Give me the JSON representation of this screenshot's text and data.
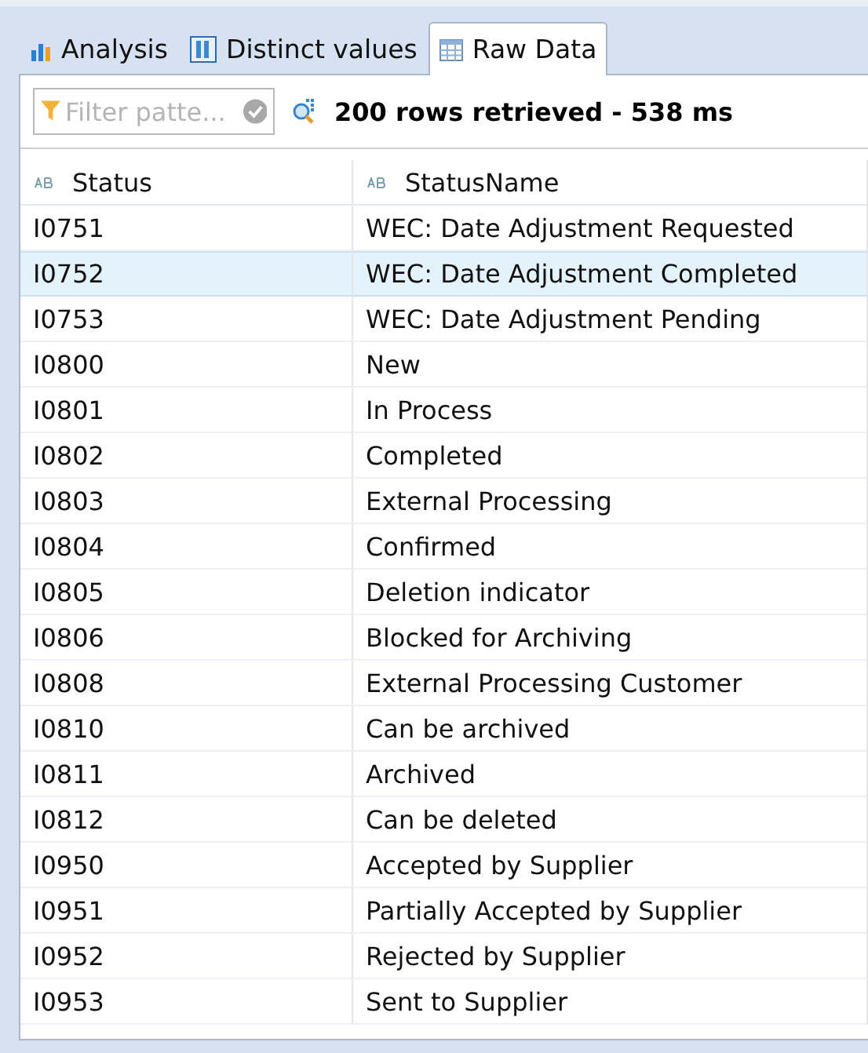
{
  "tabs": [
    {
      "label": "Analysis",
      "kind": "chart",
      "selected": false
    },
    {
      "label": "Distinct values",
      "kind": "distinct",
      "selected": false
    },
    {
      "label": "Raw Data",
      "kind": "table",
      "selected": true
    }
  ],
  "toolbar": {
    "filter": {
      "placeholder": "Filter patte..."
    },
    "status": "200 rows retrieved - 538 ms"
  },
  "table": {
    "columns": [
      "Status",
      "StatusName"
    ],
    "rows": [
      {
        "cells": [
          "I0751",
          "WEC: Date Adjustment Requested"
        ],
        "selected": false
      },
      {
        "cells": [
          "I0752",
          "WEC: Date Adjustment Completed"
        ],
        "selected": true
      },
      {
        "cells": [
          "I0753",
          "WEC: Date Adjustment Pending"
        ],
        "selected": false
      },
      {
        "cells": [
          "I0800",
          "New"
        ],
        "selected": false
      },
      {
        "cells": [
          "I0801",
          "In Process"
        ],
        "selected": false
      },
      {
        "cells": [
          "I0802",
          "Completed"
        ],
        "selected": false
      },
      {
        "cells": [
          "I0803",
          "External Processing"
        ],
        "selected": false
      },
      {
        "cells": [
          "I0804",
          "Confirmed"
        ],
        "selected": false
      },
      {
        "cells": [
          "I0805",
          "Deletion indicator"
        ],
        "selected": false
      },
      {
        "cells": [
          "I0806",
          "Blocked for Archiving"
        ],
        "selected": false
      },
      {
        "cells": [
          "I0808",
          "External Processing Customer"
        ],
        "selected": false
      },
      {
        "cells": [
          "I0810",
          "Can be archived"
        ],
        "selected": false
      },
      {
        "cells": [
          "I0811",
          "Archived"
        ],
        "selected": false
      },
      {
        "cells": [
          "I0812",
          "Can be deleted"
        ],
        "selected": false
      },
      {
        "cells": [
          "I0950",
          "Accepted by Supplier"
        ],
        "selected": false
      },
      {
        "cells": [
          "I0951",
          "Partially Accepted by Supplier"
        ],
        "selected": false
      },
      {
        "cells": [
          "I0952",
          "Rejected by Supplier"
        ],
        "selected": false
      },
      {
        "cells": [
          "I0953",
          "Sent to Supplier"
        ],
        "selected": false
      }
    ]
  }
}
